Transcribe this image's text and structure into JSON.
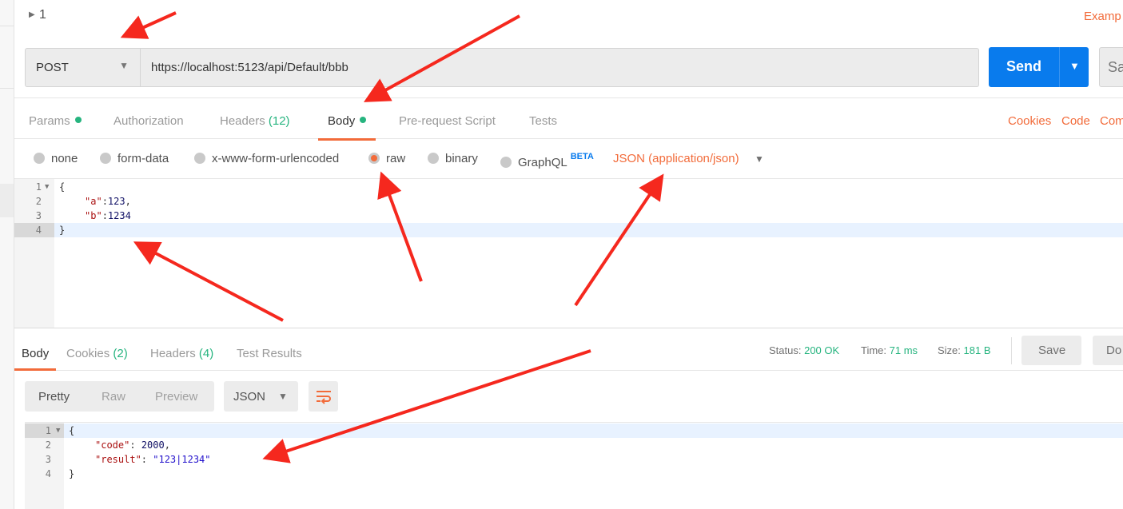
{
  "request": {
    "name": "1",
    "examples_label": "Examp",
    "method": "POST",
    "url": "https://localhost:5123/api/Default/bbb",
    "send_label": "Send",
    "save_label": "Sa"
  },
  "request_tabs": [
    {
      "label": "Params",
      "dot": true
    },
    {
      "label": "Authorization"
    },
    {
      "label": "Headers",
      "count": "(12)"
    },
    {
      "label": "Body",
      "dot": true,
      "active": true
    },
    {
      "label": "Pre-request Script"
    },
    {
      "label": "Tests"
    }
  ],
  "request_links": {
    "cookies": "Cookies",
    "code": "Code",
    "comments": "Com"
  },
  "body_types": {
    "none": "none",
    "form_data": "form-data",
    "urlencoded": "x-www-form-urlencoded",
    "raw": "raw",
    "binary": "binary",
    "graphql": "GraphQL",
    "beta": "BETA",
    "selected": "raw",
    "content_type": "JSON (application/json)"
  },
  "request_body": {
    "lines": [
      "1",
      "2",
      "3",
      "4"
    ],
    "open": "{",
    "key_a": "\"a\"",
    "val_a": "123",
    "key_b": "\"b\"",
    "val_b": "1234",
    "close": "}"
  },
  "response_tabs": [
    {
      "label": "Body",
      "active": true
    },
    {
      "label": "Cookies",
      "count": "(2)"
    },
    {
      "label": "Headers",
      "count": "(4)"
    },
    {
      "label": "Test Results"
    }
  ],
  "response_status": {
    "status_label": "Status:",
    "status": "200 OK",
    "time_label": "Time:",
    "time": "71 ms",
    "size_label": "Size:",
    "size": "181 B",
    "save_label": "Save",
    "download_label": "Do"
  },
  "response_view": {
    "modes": [
      "Pretty",
      "Raw",
      "Preview"
    ],
    "selected_mode": "Pretty",
    "format": "JSON"
  },
  "response_body": {
    "lines": [
      "1",
      "2",
      "3",
      "4"
    ],
    "open": "{",
    "key_code": "\"code\"",
    "val_code": "2000",
    "key_result": "\"result\"",
    "val_result": "\"123|1234\"",
    "close": "}"
  },
  "colors": {
    "accent": "#f26b3a",
    "send": "#097bed",
    "success": "#26b47f",
    "annotation_arrow": "#f5281e"
  }
}
